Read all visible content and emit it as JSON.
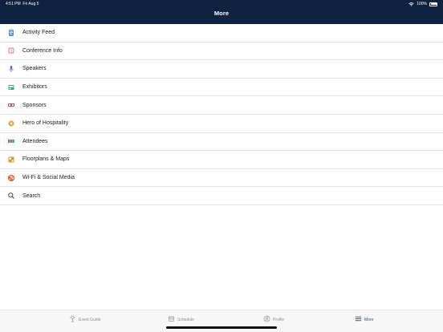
{
  "status": {
    "time": "4:51 PM",
    "date": "Fri Aug 5",
    "battery": "100%"
  },
  "header": {
    "title": "More"
  },
  "menu": [
    {
      "label": "Activity Feed",
      "icon": "activity-feed-icon",
      "color": "#5b8fd6"
    },
    {
      "label": "Conference Info",
      "icon": "conference-info-icon",
      "color": "#e34f4f"
    },
    {
      "label": "Speakers",
      "icon": "speakers-icon",
      "color": "#4a6fb5"
    },
    {
      "label": "Exhibitors",
      "icon": "exhibitors-icon",
      "color": "#4aa07a"
    },
    {
      "label": "Sponsors",
      "icon": "sponsors-icon",
      "color": "#d04b6a"
    },
    {
      "label": "Hero of Hospitality",
      "icon": "hero-icon",
      "color": "#e6a72c"
    },
    {
      "label": "Attendees",
      "icon": "attendees-icon",
      "color": "#3b8bd0"
    },
    {
      "label": "Floorplans & Maps",
      "icon": "floorplans-icon",
      "color": "#d69a2f"
    },
    {
      "label": "Wi-Fi & Social Media",
      "icon": "wifi-social-icon",
      "color": "#e25a3a"
    },
    {
      "label": "Search",
      "icon": "search-icon",
      "color": "#444a52"
    }
  ],
  "tabs": [
    {
      "label": "Event Guide",
      "icon": "event-guide-icon",
      "active": false
    },
    {
      "label": "Schedule",
      "icon": "schedule-icon",
      "active": false
    },
    {
      "label": "Profile",
      "icon": "profile-icon",
      "active": false
    },
    {
      "label": "More",
      "icon": "more-icon",
      "active": true
    }
  ],
  "colors": {
    "header_bg": "#0f2340",
    "active_tab": "#2d4a72",
    "inactive_tab": "#8a8f96"
  }
}
